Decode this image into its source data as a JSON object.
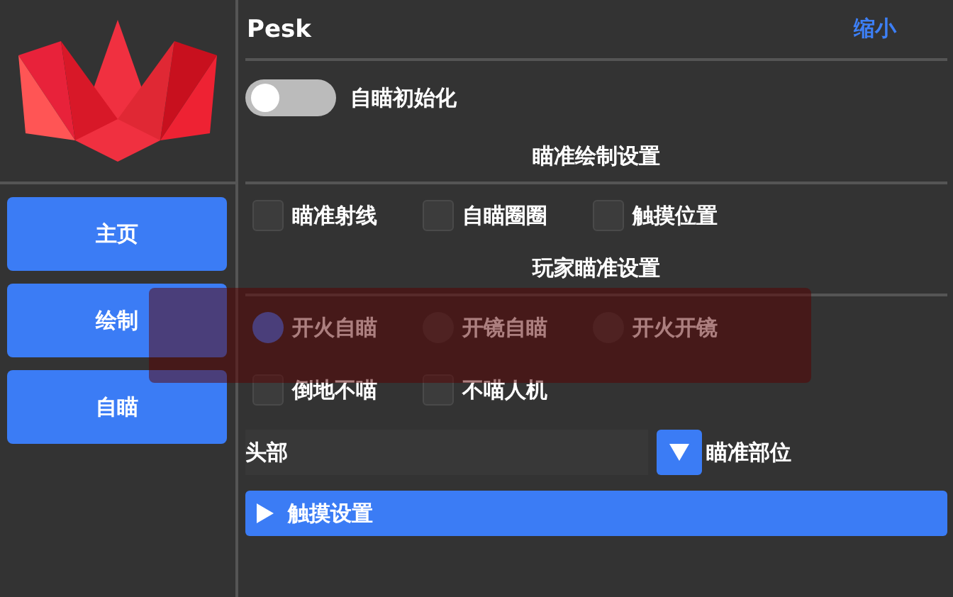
{
  "sidebar": {
    "items": [
      {
        "label": "主页",
        "selected": false
      },
      {
        "label": "绘制",
        "selected": false
      },
      {
        "label": "自瞄",
        "selected": false
      }
    ]
  },
  "header": {
    "title": "Pesk",
    "action": "缩小"
  },
  "init_toggle": {
    "label": "自瞄初始化",
    "on": false
  },
  "sections": [
    {
      "title": "瞄准绘制设置",
      "rows": [
        [
          {
            "kind": "checkbox",
            "label": "瞄准射线",
            "checked": false
          },
          {
            "kind": "checkbox",
            "label": "自瞄圈圈",
            "checked": false
          },
          {
            "kind": "checkbox",
            "label": "触摸位置",
            "checked": false
          }
        ]
      ]
    },
    {
      "title": "玩家瞄准设置",
      "rows": [
        [
          {
            "kind": "radio",
            "label": "开火自瞄",
            "selected": true
          },
          {
            "kind": "radio",
            "label": "开镜自瞄",
            "selected": false
          },
          {
            "kind": "radio",
            "label": "开火开镜",
            "selected": false
          }
        ],
        [
          {
            "kind": "checkbox",
            "label": "倒地不喵",
            "checked": false
          },
          {
            "kind": "checkbox",
            "label": "不喵人机",
            "checked": false
          }
        ]
      ]
    }
  ],
  "aim_part": {
    "value": "头部",
    "label": "瞄准部位"
  },
  "touch_settings": {
    "label": "触摸设置",
    "expanded": false
  }
}
